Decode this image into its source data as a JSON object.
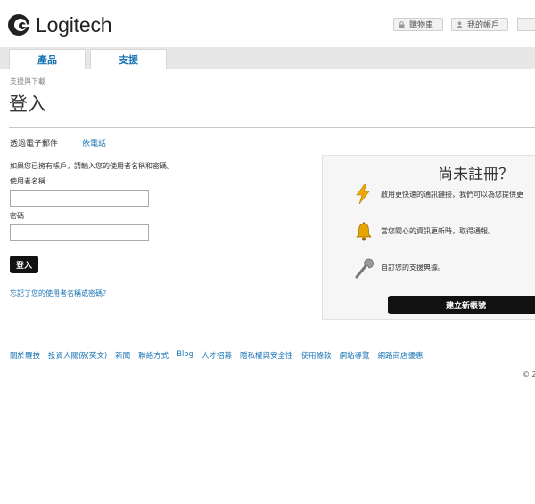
{
  "brand": {
    "name": "Logitech"
  },
  "header": {
    "cart_label": "購物車",
    "account_label": "我的帳戶"
  },
  "nav": {
    "tabs": [
      {
        "label": "產品"
      },
      {
        "label": "支援"
      }
    ]
  },
  "breadcrumb": "支援與下載",
  "page_title": "登入",
  "login_tabs": {
    "email": "透過電子郵件",
    "phone": "依電話"
  },
  "login_form": {
    "intro": "如果您已擁有帳戶，請輸入您的使用者名稱和密碼。",
    "username_label": "使用者名稱",
    "username_value": "",
    "password_label": "密碼",
    "password_value": "",
    "submit_label": "登入",
    "forgot_link": "忘記了您的使用者名稱或密碼？"
  },
  "register_panel": {
    "title": "尚未註冊？",
    "benefits": [
      {
        "icon": "lightning-icon",
        "text": "啟用更快速的通訊鏈接，我們可以為您提供更"
      },
      {
        "icon": "bell-icon",
        "text": "當您關心的資訊更新時，取得通報。"
      },
      {
        "icon": "wrench-icon",
        "text": "自訂您的支援典據。"
      }
    ],
    "button_label": "建立新帳號"
  },
  "footer": {
    "links": [
      "關於羅技",
      "投資人關係(英文)",
      "新聞",
      "聯絡方式",
      "Blog",
      "人才招募",
      "隱私權與安全性",
      "使用條款",
      "網站導覽",
      "網路商店優惠"
    ],
    "copyright": "© 2"
  },
  "colors": {
    "link": "#1a73b5",
    "button": "#111111",
    "nav_bg": "#e7e7e7",
    "panel_bg": "#f6f6f6"
  }
}
